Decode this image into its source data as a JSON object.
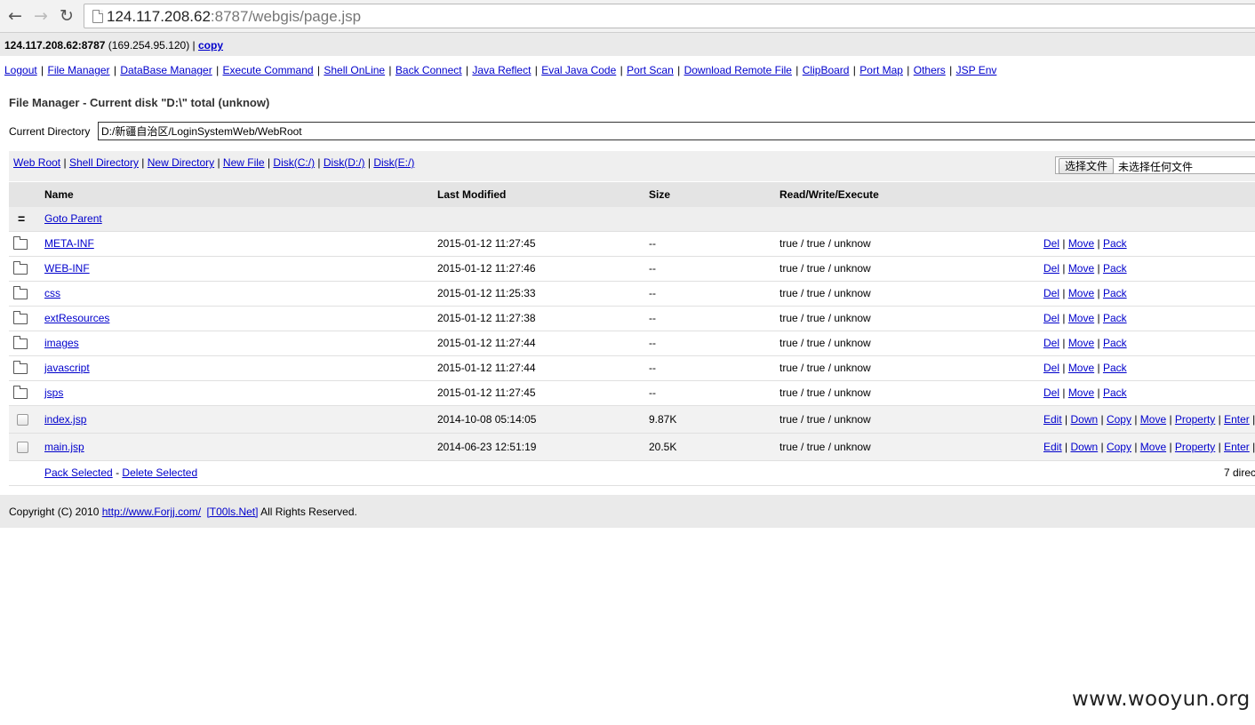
{
  "browser": {
    "url_host": "124.117.208.62",
    "url_rest": ":8787/webgis/page.jsp"
  },
  "hostline": {
    "host": "124.117.208.62:8787",
    "local_ip": "169.254.95.120",
    "copy_label": "copy"
  },
  "menu": [
    "Logout",
    "File Manager",
    "DataBase Manager",
    "Execute Command",
    "Shell OnLine",
    "Back Connect",
    "Java Reflect",
    "Eval Java Code",
    "Port Scan",
    "Download Remote File",
    "ClipBoard",
    "Port Map",
    "Others",
    "JSP Env"
  ],
  "title": "File Manager - Current disk \"D:\\\" total (unknow)",
  "directory": {
    "label": "Current Directory",
    "value": "D:/新疆自治区/LoginSystemWeb/WebRoot"
  },
  "actions": [
    "Web Root",
    "Shell Directory",
    "New Directory",
    "New File",
    "Disk(C:/)",
    "Disk(D:/)",
    "Disk(E:/)"
  ],
  "upload": {
    "button": "选择文件",
    "status": "未选择任何文件"
  },
  "table": {
    "headers": [
      "Name",
      "Last Modified",
      "Size",
      "Read/Write/Execute"
    ],
    "parent_icon": "=",
    "parent_label": "Goto Parent",
    "folders": [
      {
        "name": "META-INF",
        "modified": "2015-01-12 11:27:45",
        "size": "--",
        "rwe": "true / true / unknow"
      },
      {
        "name": "WEB-INF",
        "modified": "2015-01-12 11:27:46",
        "size": "--",
        "rwe": "true / true / unknow"
      },
      {
        "name": "css",
        "modified": "2015-01-12 11:25:33",
        "size": "--",
        "rwe": "true / true / unknow"
      },
      {
        "name": "extResources",
        "modified": "2015-01-12 11:27:38",
        "size": "--",
        "rwe": "true / true / unknow"
      },
      {
        "name": "images",
        "modified": "2015-01-12 11:27:44",
        "size": "--",
        "rwe": "true / true / unknow"
      },
      {
        "name": "javascript",
        "modified": "2015-01-12 11:27:44",
        "size": "--",
        "rwe": "true / true / unknow"
      },
      {
        "name": "jsps",
        "modified": "2015-01-12 11:27:45",
        "size": "--",
        "rwe": "true / true / unknow"
      }
    ],
    "folder_actions": [
      "Del",
      "Move",
      "Pack"
    ],
    "files": [
      {
        "name": "index.jsp",
        "modified": "2014-10-08 05:14:05",
        "size": "9.87K",
        "rwe": "true / true / unknow"
      },
      {
        "name": "main.jsp",
        "modified": "2014-06-23 12:51:19",
        "size": "20.5K",
        "rwe": "true / true / unknow"
      }
    ],
    "file_actions": [
      "Edit",
      "Down",
      "Copy",
      "Move",
      "Property",
      "Enter"
    ],
    "pack_selected": "Pack Selected",
    "delete_selected": "Delete Selected",
    "count_text": "7 direc"
  },
  "footer": {
    "prefix": "Copyright (C) 2010",
    "link1": "http://www.Forjj.com/",
    "link2": "[T00ls.Net]",
    "suffix": "All Rights Reserved."
  },
  "watermark": "www.wooyun.org"
}
